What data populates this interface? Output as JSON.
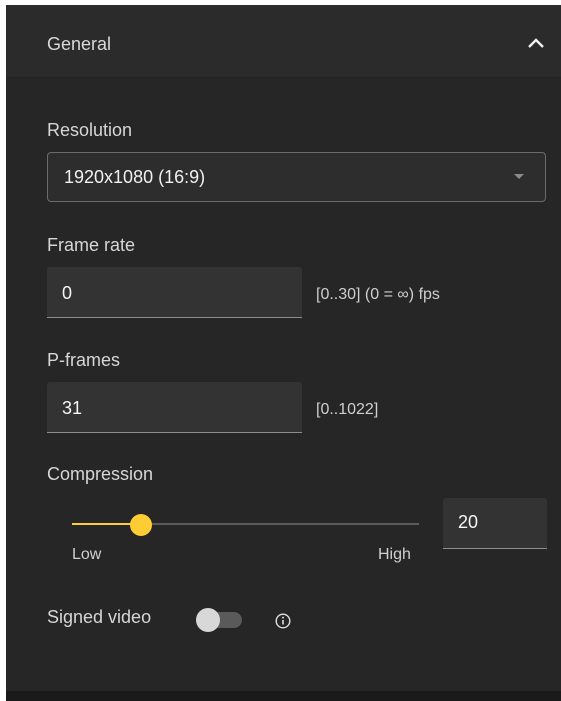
{
  "section": {
    "title": "General",
    "expanded": true
  },
  "resolution": {
    "label": "Resolution",
    "value": "1920x1080 (16:9)"
  },
  "frame_rate": {
    "label": "Frame rate",
    "value": "0",
    "hint": "[0..30] (0 = ∞) fps"
  },
  "p_frames": {
    "label": "P-frames",
    "value": "31",
    "hint": "[0..1022]"
  },
  "compression": {
    "label": "Compression",
    "value": "20",
    "slider_level": 0.2,
    "low_label": "Low",
    "high_label": "High"
  },
  "signed_video": {
    "label": "Signed video",
    "enabled": false
  },
  "colors": {
    "accent": "#ffcc33",
    "panel_bg": "#262626"
  },
  "icons": {
    "collapse": "chevron-up-icon",
    "dropdown": "caret-down-icon",
    "info": "info-icon"
  }
}
